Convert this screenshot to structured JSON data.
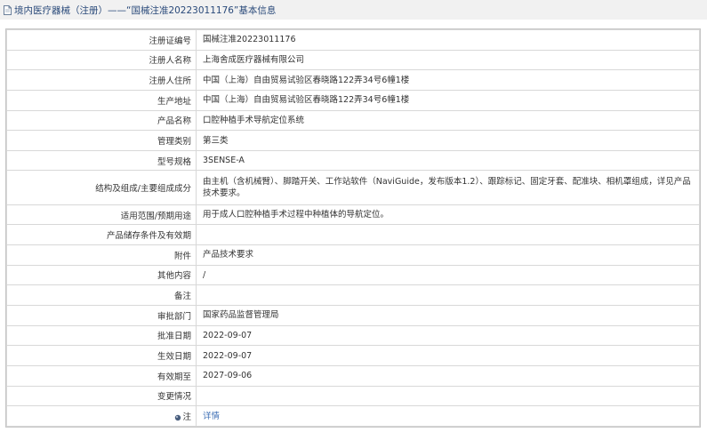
{
  "header": {
    "title": "境内医疗器械（注册）——“国械注准20223011176”基本信息",
    "icon": "document-icon"
  },
  "rows": [
    {
      "label": "注册证编号",
      "value": "国械注准20223011176"
    },
    {
      "label": "注册人名称",
      "value": "上海舍成医疗器械有限公司"
    },
    {
      "label": "注册人住所",
      "value": "中国（上海）自由贸易试验区春晓路122弄34号6幢1楼"
    },
    {
      "label": "生产地址",
      "value": "中国（上海）自由贸易试验区春晓路122弄34号6幢1楼"
    },
    {
      "label": "产品名称",
      "value": "口腔种植手术导航定位系统"
    },
    {
      "label": "管理类别",
      "value": "第三类"
    },
    {
      "label": "型号规格",
      "value": "3SENSE-A"
    },
    {
      "label": "结构及组成/主要组成成分",
      "value": "由主机（含机械臂）、脚踏开关、工作站软件（NaviGuide，发布版本1.2）、跟踪标记、固定牙套、配准块、相机罩组成，详见产品技术要求。"
    },
    {
      "label": "适用范围/预期用途",
      "value": "用于成人口腔种植手术过程中种植体的导航定位。"
    },
    {
      "label": "产品储存条件及有效期",
      "value": ""
    },
    {
      "label": "附件",
      "value": "产品技术要求"
    },
    {
      "label": "其他内容",
      "value": "/"
    },
    {
      "label": "备注",
      "value": ""
    },
    {
      "label": "审批部门",
      "value": "国家药品监督管理局"
    },
    {
      "label": "批准日期",
      "value": "2022-09-07"
    },
    {
      "label": "生效日期",
      "value": "2022-09-07"
    },
    {
      "label": "有效期至",
      "value": "2027-09-06"
    },
    {
      "label": "变更情况",
      "value": ""
    }
  ],
  "note": {
    "label": "注",
    "icon": "bullet-icon",
    "link": "详情",
    "link_color": "#3d6fb5"
  }
}
